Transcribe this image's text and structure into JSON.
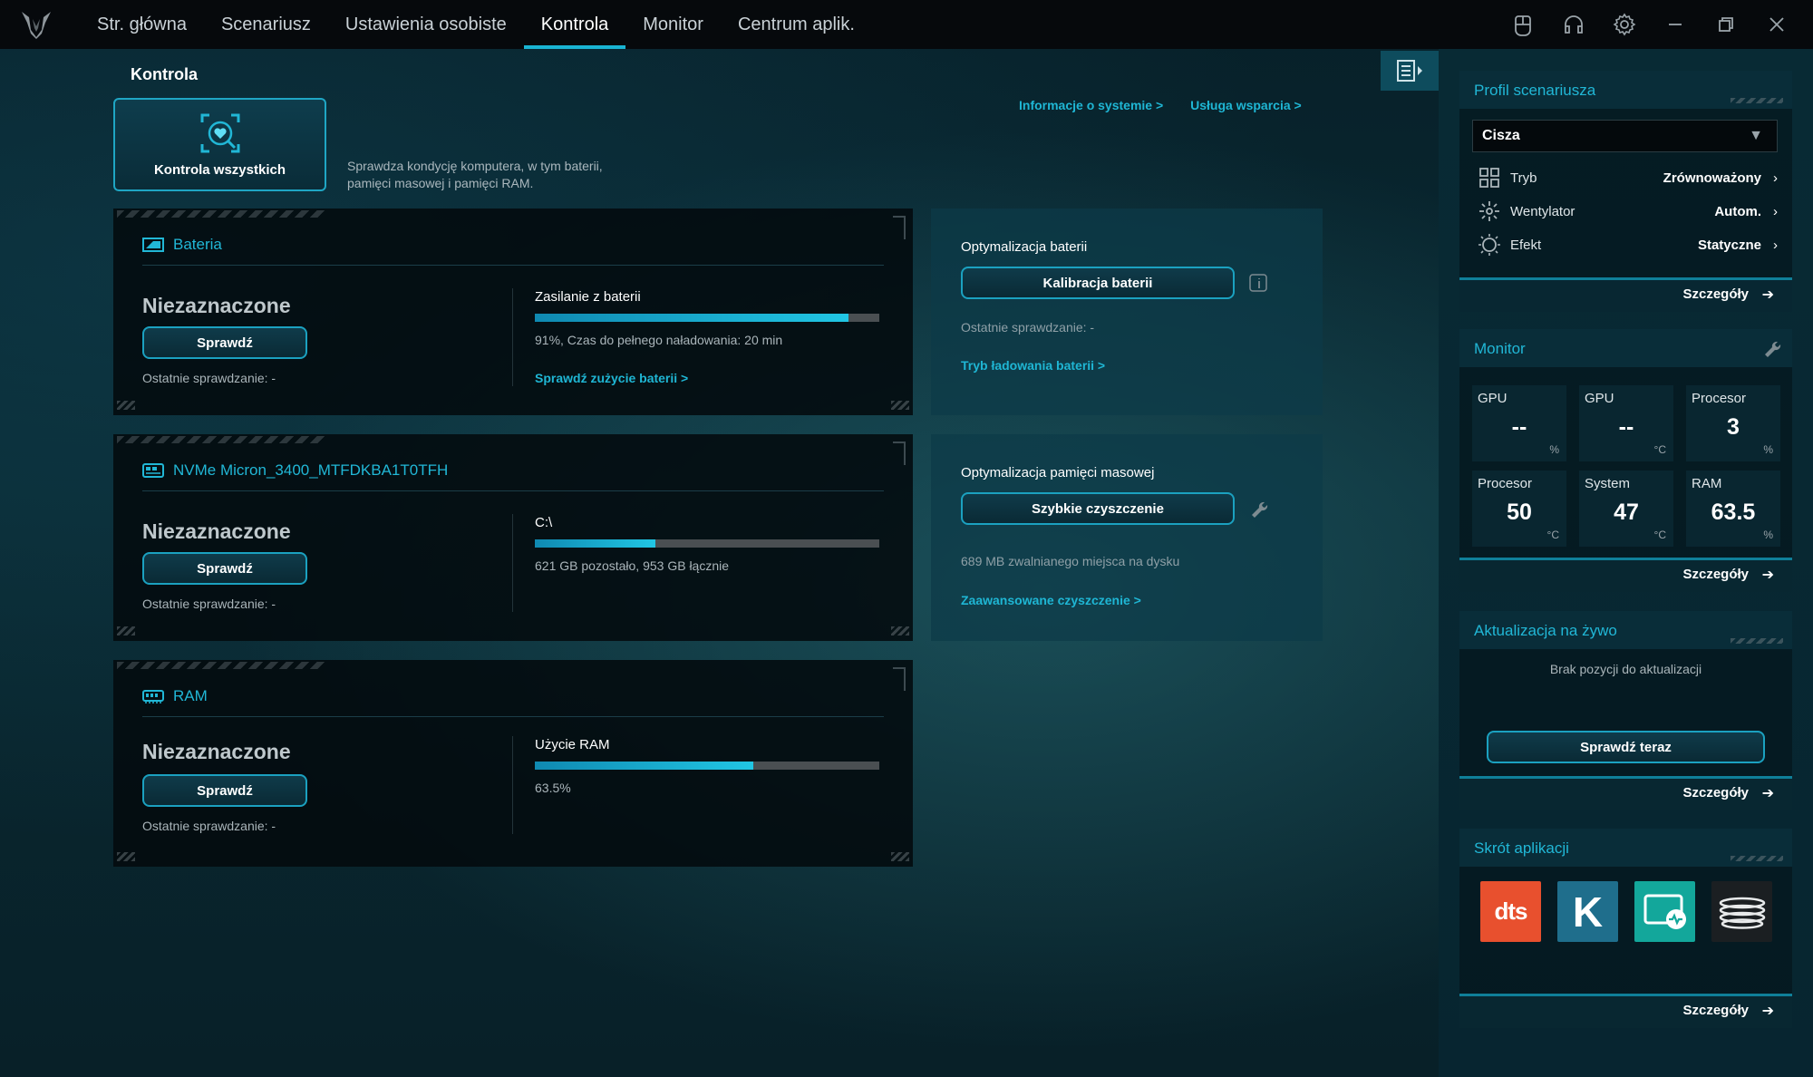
{
  "nav": {
    "items": [
      "Str. główna",
      "Scenariusz",
      "Ustawienia osobiste",
      "Kontrola",
      "Monitor",
      "Centrum aplik."
    ],
    "active_index": 3
  },
  "page": {
    "title": "Kontrola",
    "check_all_label": "Kontrola wszystkich",
    "check_all_desc_line1": "Sprawdza kondycję komputera, w tym baterii,",
    "check_all_desc_line2": "pamięci masowej i pamięci RAM.",
    "link_system_info": "Informacje o systemie >",
    "link_support": "Usługa wsparcia >"
  },
  "cards": {
    "battery": {
      "title": "Bateria",
      "status": "Niezaznaczone",
      "check_btn": "Sprawdź",
      "last_check": "Ostatnie sprawdzanie: -",
      "metric_title": "Zasilanie z baterii",
      "metric_fill_pct": 91,
      "metric_desc": "91%, Czas do pełnego naładowania: 20 min",
      "metric_link": "Sprawdź zużycie baterii >"
    },
    "storage": {
      "title": "NVMe Micron_3400_MTFDKBA1T0TFH",
      "status": "Niezaznaczone",
      "check_btn": "Sprawdź",
      "last_check": "Ostatnie sprawdzanie: -",
      "metric_title": "C:\\",
      "metric_fill_pct": 35,
      "metric_desc": "621 GB pozostało, 953 GB łącznie"
    },
    "ram": {
      "title": "RAM",
      "status": "Niezaznaczone",
      "check_btn": "Sprawdź",
      "last_check": "Ostatnie sprawdzanie: -",
      "metric_title": "Użycie RAM",
      "metric_fill_pct": 63.5,
      "metric_desc": "63.5%"
    }
  },
  "optimize": {
    "battery": {
      "title": "Optymalizacja baterii",
      "button": "Kalibracja baterii",
      "last_check": "Ostatnie sprawdzanie: -",
      "link": "Tryb ładowania baterii >"
    },
    "storage": {
      "title": "Optymalizacja pamięci masowej",
      "button": "Szybkie czyszczenie",
      "note": "689 MB zwalnianego miejsca na dysku",
      "link": "Zaawansowane czyszczenie >"
    }
  },
  "sidebar": {
    "profile": {
      "title": "Profil scenariusza",
      "selected": "Cisza",
      "rows": [
        {
          "key": "Tryb",
          "value": "Zrównoważony",
          "icon": "grid-icon"
        },
        {
          "key": "Wentylator",
          "value": "Autom.",
          "icon": "fan-icon"
        },
        {
          "key": "Efekt",
          "value": "Statyczne",
          "icon": "light-effect-icon"
        }
      ],
      "details": "Szczegóły"
    },
    "monitor": {
      "title": "Monitor",
      "cells": [
        {
          "name": "GPU",
          "value": "--",
          "unit": "%"
        },
        {
          "name": "GPU",
          "value": "--",
          "unit": "°C"
        },
        {
          "name": "Procesor",
          "value": "3",
          "unit": "%"
        },
        {
          "name": "Procesor",
          "value": "50",
          "unit": "°C"
        },
        {
          "name": "System",
          "value": "47",
          "unit": "°C"
        },
        {
          "name": "RAM",
          "value": "63.5",
          "unit": "%"
        }
      ],
      "details": "Szczegóły"
    },
    "live_update": {
      "title": "Aktualizacja na żywo",
      "message": "Brak pozycji do aktualizacji",
      "button": "Sprawdź teraz",
      "details": "Szczegóły"
    },
    "shortcuts": {
      "title": "Skrót aplikacji",
      "apps": [
        {
          "name": "dts",
          "label": "dts",
          "color": "#e8502e"
        },
        {
          "name": "k",
          "label": "K",
          "color": "#1f6e8c"
        },
        {
          "name": "monitor-app",
          "label": "",
          "color": "#13a79b"
        },
        {
          "name": "coil-app",
          "label": "",
          "color": "#1b1f22"
        }
      ],
      "details": "Szczegóły"
    }
  },
  "colors": {
    "accent": "#21b7d6",
    "topbar": "#06090c",
    "bar_fill": "#1bb8da"
  }
}
